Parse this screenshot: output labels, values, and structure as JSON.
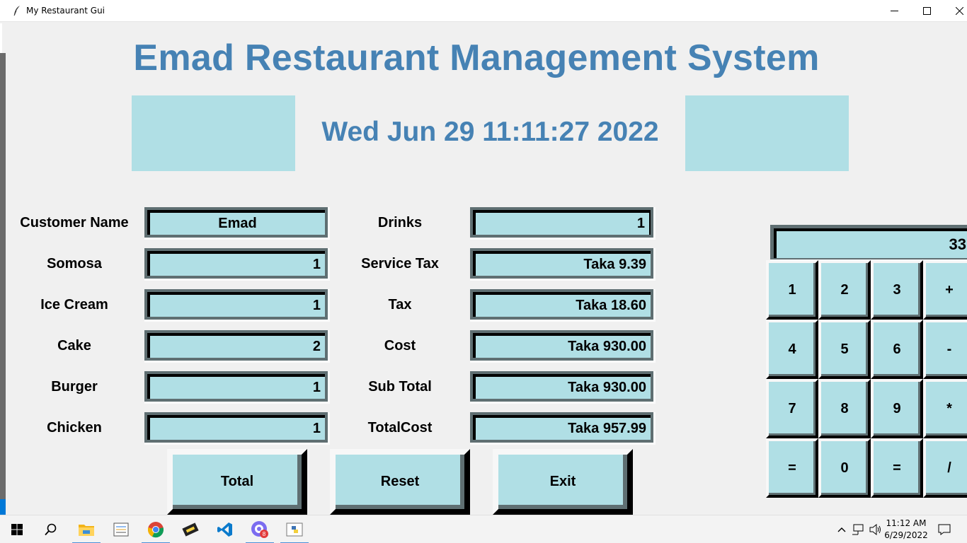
{
  "window": {
    "title": "My Restaurant Gui",
    "controls": {
      "minimize": "minimize-icon",
      "maximize": "maximize-icon",
      "close": "close-icon"
    }
  },
  "header": {
    "title": "Emad Restaurant Management System",
    "datetime": "Wed Jun 29 11:11:27 2022"
  },
  "colors": {
    "accent": "#4682b4",
    "field_bg": "#b0dfe5",
    "panel_bg": "#f0f0f0"
  },
  "left_fields": [
    {
      "label": "Customer Name",
      "value": "Emad"
    },
    {
      "label": "Somosa",
      "value": "1"
    },
    {
      "label": "Ice Cream",
      "value": "1"
    },
    {
      "label": "Cake",
      "value": "2"
    },
    {
      "label": "Burger",
      "value": "1"
    },
    {
      "label": "Chicken",
      "value": "1"
    }
  ],
  "right_fields": [
    {
      "label": "Drinks",
      "value": "1"
    },
    {
      "label": "Service Tax",
      "value": "Taka 9.39"
    },
    {
      "label": "Tax",
      "value": "Taka 18.60"
    },
    {
      "label": "Cost",
      "value": "Taka 930.00"
    },
    {
      "label": "Sub Total",
      "value": "Taka 930.00"
    },
    {
      "label": "TotalCost",
      "value": "Taka 957.99"
    }
  ],
  "actions": {
    "total": "Total",
    "reset": "Reset",
    "exit": "Exit"
  },
  "calculator": {
    "display": "33",
    "keys": [
      "1",
      "2",
      "3",
      "+",
      "4",
      "5",
      "6",
      "-",
      "7",
      "8",
      "9",
      "*",
      "=",
      "0",
      "=",
      "/"
    ]
  },
  "taskbar": {
    "items": [
      "windows-start-icon",
      "search-icon",
      "file-explorer-icon",
      "app-icon",
      "chrome-icon",
      "app-icon",
      "vscode-icon",
      "discord-icon",
      "python-icon"
    ],
    "clock": {
      "time": "11:12 AM",
      "date": "6/29/2022"
    }
  }
}
